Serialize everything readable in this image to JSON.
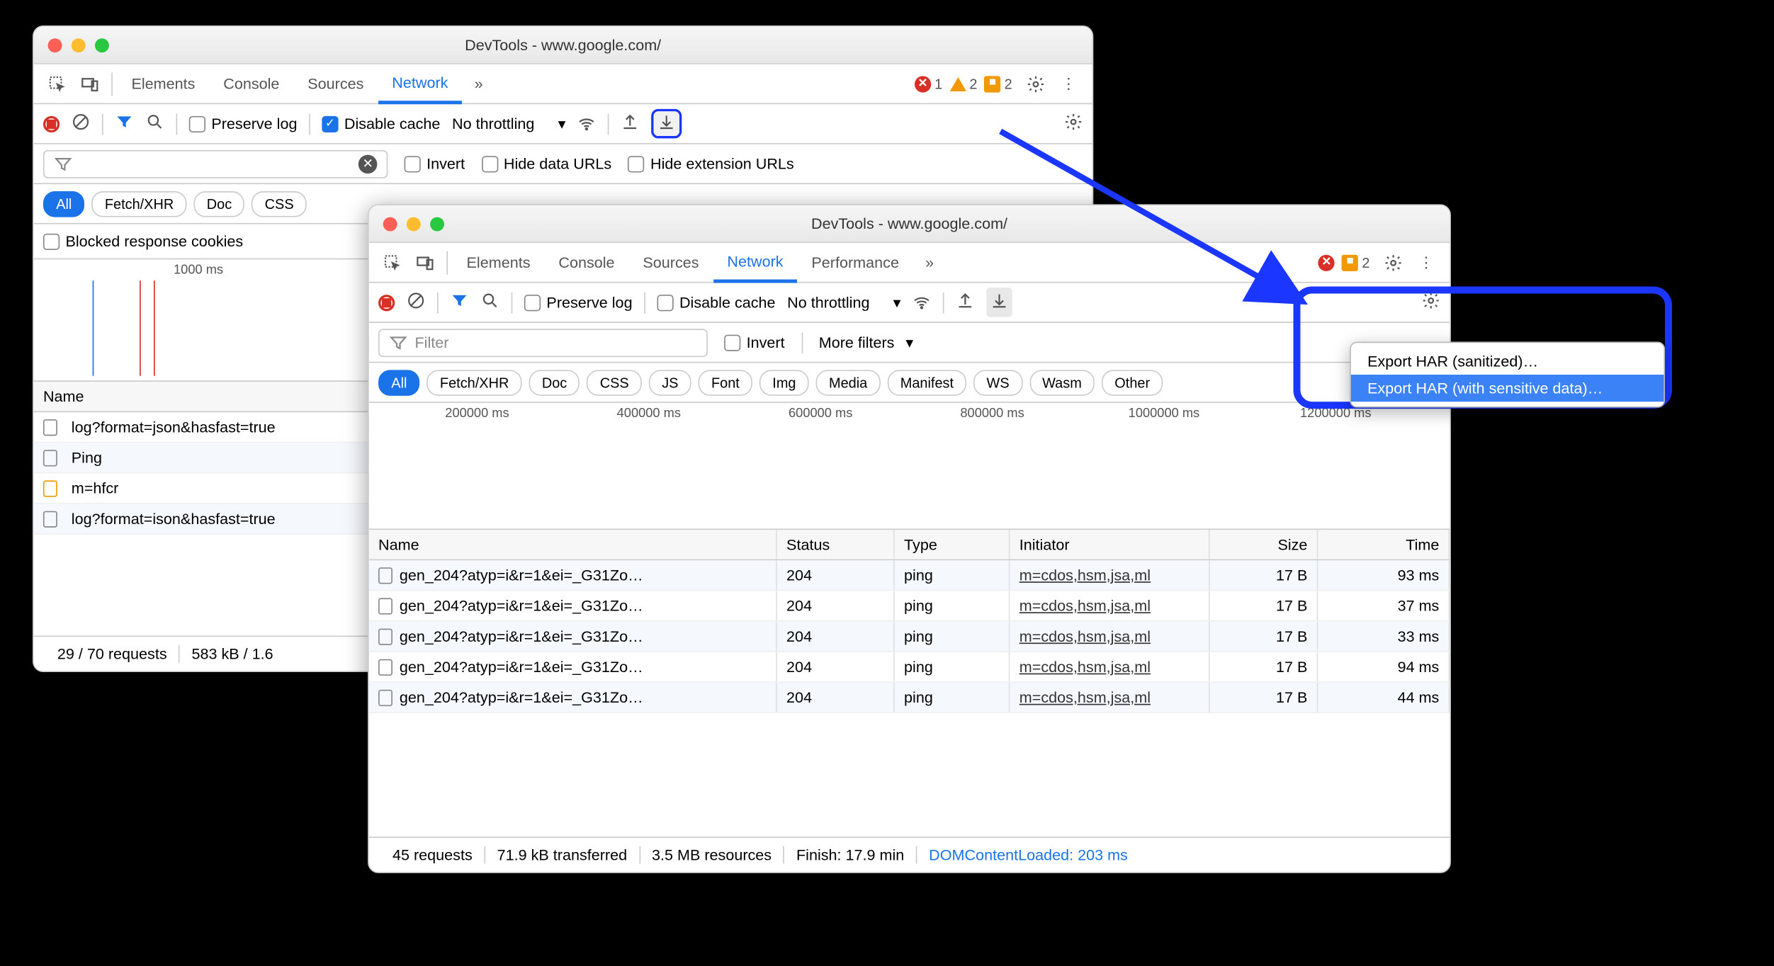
{
  "windowBack": {
    "title": "DevTools - www.google.com/",
    "tabs": [
      "Elements",
      "Console",
      "Sources",
      "Network"
    ],
    "activeTab": "Network",
    "badges": {
      "errors": "1",
      "warnings": "2",
      "feedback": "2"
    },
    "toolbar": {
      "preserve_log": "Preserve log",
      "disable_cache": "Disable cache",
      "throttling": "No throttling"
    },
    "filterbar": {
      "invert": "Invert",
      "hide_data": "Hide data URLs",
      "hide_ext": "Hide extension URLs"
    },
    "chips": [
      "All",
      "Fetch/XHR",
      "Doc",
      "CSS"
    ],
    "blocked_cookies": "Blocked response cookies",
    "timeline_label": "1000 ms",
    "name_header": "Name",
    "rows": [
      "log?format=json&hasfast=true",
      "Ping",
      "m=hfcr",
      "log?format=ison&hasfast=true"
    ],
    "status": {
      "requests": "29 / 70 requests",
      "size": "583 kB / 1.6"
    }
  },
  "windowFront": {
    "title": "DevTools - www.google.com/",
    "tabs": [
      "Elements",
      "Console",
      "Sources",
      "Network",
      "Performance"
    ],
    "activeTab": "Network",
    "badges": {
      "feedback": "2"
    },
    "toolbar": {
      "preserve_log": "Preserve log",
      "disable_cache": "Disable cache",
      "throttling": "No throttling"
    },
    "filterbar": {
      "placeholder": "Filter",
      "invert": "Invert",
      "more_filters": "More filters"
    },
    "chips": [
      "All",
      "Fetch/XHR",
      "Doc",
      "CSS",
      "JS",
      "Font",
      "Img",
      "Media",
      "Manifest",
      "WS",
      "Wasm",
      "Other"
    ],
    "timeline_labels": [
      "200000 ms",
      "400000 ms",
      "600000 ms",
      "800000 ms",
      "1000000 ms",
      "1200000 ms"
    ],
    "columns": {
      "name": "Name",
      "status": "Status",
      "type": "Type",
      "initiator": "Initiator",
      "size": "Size",
      "time": "Time"
    },
    "rows": [
      {
        "name": "gen_204?atyp=i&r=1&ei=_G31Zo…",
        "status": "204",
        "type": "ping",
        "initiator": "m=cdos,hsm,jsa,ml",
        "size": "17 B",
        "time": "93 ms"
      },
      {
        "name": "gen_204?atyp=i&r=1&ei=_G31Zo…",
        "status": "204",
        "type": "ping",
        "initiator": "m=cdos,hsm,jsa,ml",
        "size": "17 B",
        "time": "37 ms"
      },
      {
        "name": "gen_204?atyp=i&r=1&ei=_G31Zo…",
        "status": "204",
        "type": "ping",
        "initiator": "m=cdos,hsm,jsa,ml",
        "size": "17 B",
        "time": "33 ms"
      },
      {
        "name": "gen_204?atyp=i&r=1&ei=_G31Zo…",
        "status": "204",
        "type": "ping",
        "initiator": "m=cdos,hsm,jsa,ml",
        "size": "17 B",
        "time": "94 ms"
      },
      {
        "name": "gen_204?atyp=i&r=1&ei=_G31Zo…",
        "status": "204",
        "type": "ping",
        "initiator": "m=cdos,hsm,jsa,ml",
        "size": "17 B",
        "time": "44 ms"
      }
    ],
    "status": {
      "requests": "45 requests",
      "transferred": "71.9 kB transferred",
      "resources": "3.5 MB resources",
      "finish": "Finish: 17.9 min",
      "dom": "DOMContentLoaded: 203 ms"
    }
  },
  "dropdown": {
    "item1": "Export HAR (sanitized)…",
    "item2": "Export HAR (with sensitive data)…"
  }
}
